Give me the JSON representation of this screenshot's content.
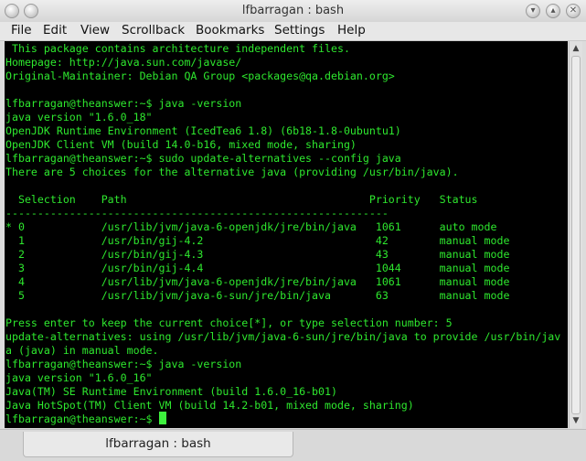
{
  "window": {
    "title": "lfbarragan : bash",
    "icons": {
      "menu": "window-menu-icon",
      "pin": "pin-icon",
      "minimize": "minimize-icon",
      "maximize": "maximize-icon",
      "close": "close-icon"
    }
  },
  "menubar": {
    "items": [
      "File",
      "Edit",
      "View",
      "Scrollback",
      "Bookmarks",
      "Settings",
      "Help"
    ]
  },
  "terminal": {
    "colors": {
      "background": "#000000",
      "text": "#2ee82e"
    },
    "lines": [
      " This package contains architecture independent files.",
      "Homepage: http://java.sun.com/javase/",
      "Original-Maintainer: Debian QA Group <packages@qa.debian.org>",
      "",
      "lfbarragan@theanswer:~$ java -version",
      "java version \"1.6.0_18\"",
      "OpenJDK Runtime Environment (IcedTea6 1.8) (6b18-1.8-0ubuntu1)",
      "OpenJDK Client VM (build 14.0-b16, mixed mode, sharing)",
      "lfbarragan@theanswer:~$ sudo update-alternatives --config java",
      "There are 5 choices for the alternative java (providing /usr/bin/java).",
      "",
      "  Selection    Path                                      Priority   Status",
      "------------------------------------------------------------",
      "* 0            /usr/lib/jvm/java-6-openjdk/jre/bin/java   1061      auto mode",
      "  1            /usr/bin/gij-4.2                           42        manual mode",
      "  2            /usr/bin/gij-4.3                           43        manual mode",
      "  3            /usr/bin/gij-4.4                           1044      manual mode",
      "  4            /usr/lib/jvm/java-6-openjdk/jre/bin/java   1061      manual mode",
      "  5            /usr/lib/jvm/java-6-sun/jre/bin/java       63        manual mode",
      "",
      "Press enter to keep the current choice[*], or type selection number: 5",
      "update-alternatives: using /usr/lib/jvm/java-6-sun/jre/bin/java to provide /usr/bin/jav",
      "a (java) in manual mode.",
      "lfbarragan@theanswer:~$ java -version",
      "java version \"1.6.0_16\"",
      "Java(TM) SE Runtime Environment (build 1.6.0_16-b01)",
      "Java HotSpot(TM) Client VM (build 14.2-b01, mixed mode, sharing)",
      "lfbarragan@theanswer:~$ "
    ]
  },
  "tabs": [
    {
      "label": "lfbarragan : bash",
      "icon": "terminal-icon"
    }
  ]
}
